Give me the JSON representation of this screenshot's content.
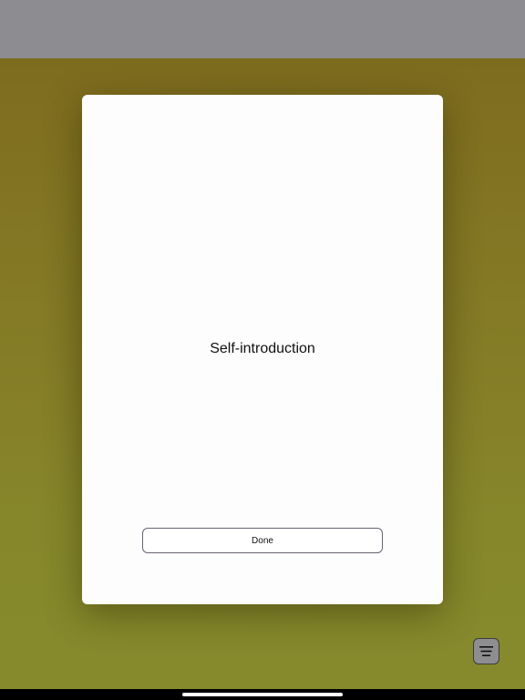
{
  "modal": {
    "title": "Self-introduction",
    "done_label": "Done"
  },
  "menu_button": {
    "icon": "hamburger-menu-icon"
  },
  "colors": {
    "status_bar": "#8d8c90",
    "backdrop": "#8a7f24",
    "modal_background": "#fdfdfd",
    "button_border": "#6b6372"
  }
}
